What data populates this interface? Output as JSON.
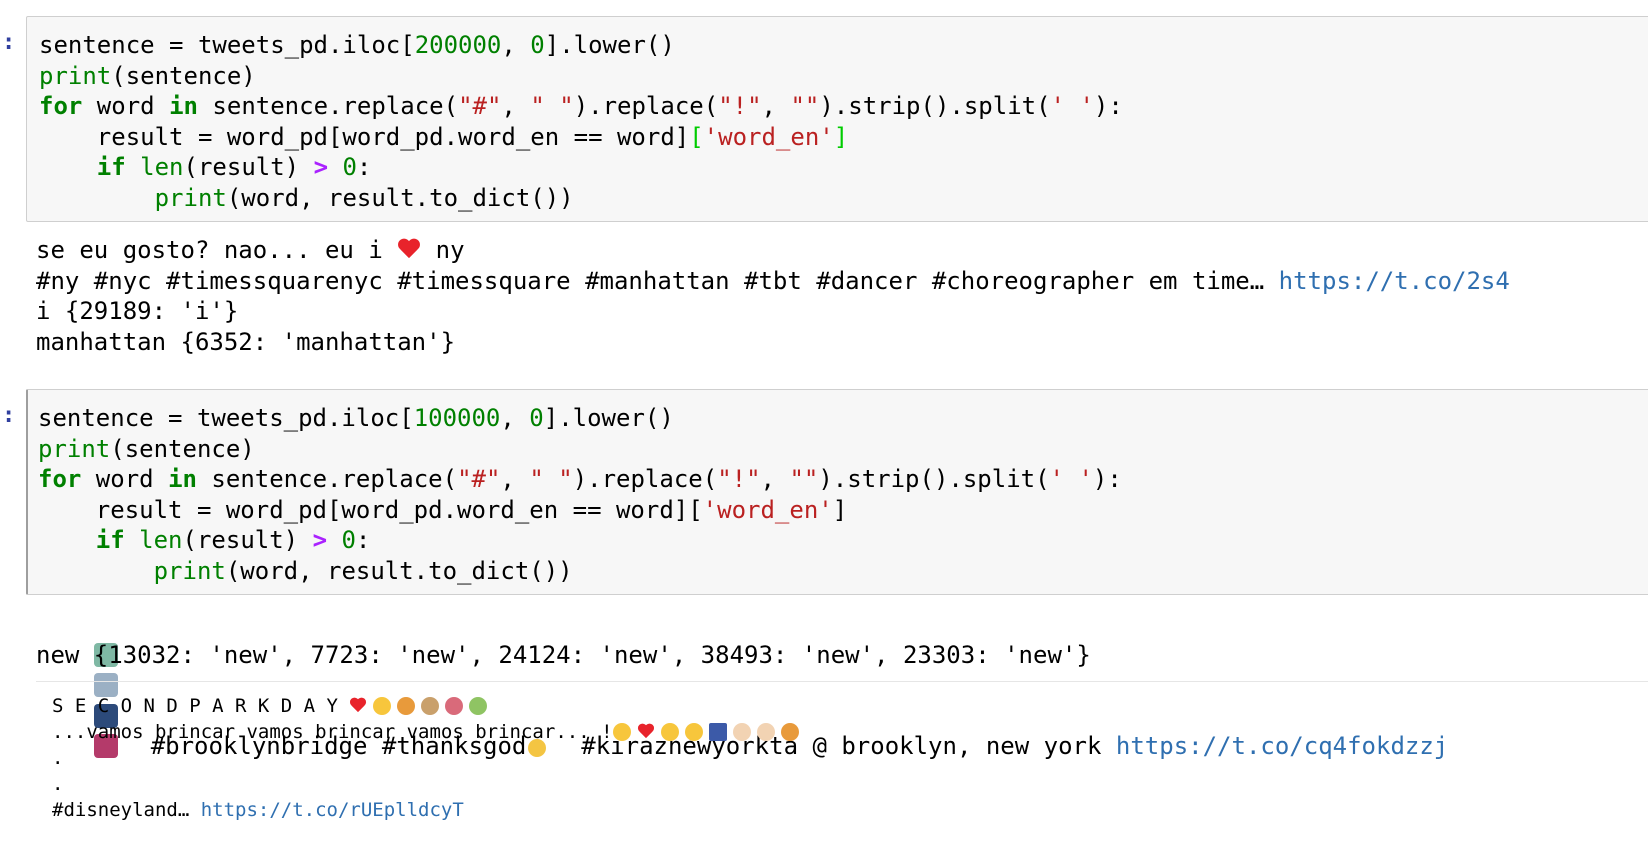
{
  "cells": [
    {
      "prompt": ":",
      "code": {
        "l1": {
          "a": "sentence = tweets_pd.iloc[",
          "n1": "200000",
          ", ": ", ",
          "n2": "0",
          "b": "].lower()"
        },
        "l2": {
          "fn": "print",
          "rest": "(sentence)"
        },
        "l3": {
          "kw1": "for",
          "mid1": " word ",
          "kw2": "in",
          "mid2": " sentence.replace(",
          "s1": "\"#\"",
          "c1": ", ",
          "s2": "\" \"",
          "mid3": ").replace(",
          "s3": "\"!\"",
          "c2": ", ",
          "s4": "\"\"",
          "mid4": ").strip().split(",
          "s5": "' '",
          "end": "):"
        },
        "l4": {
          "a": "    result = word_pd[word_pd.word_en == word]",
          "b1": "[",
          "s": "'word_en'",
          "b2": "]"
        },
        "l5": {
          "indent": "    ",
          "kw": "if",
          "sp": " ",
          "fn": "len",
          "mid": "(result) ",
          "op": ">",
          "sp2": " ",
          "n": "0",
          ":": ":"
        },
        "l6": {
          "indent": "        ",
          "fn": "print",
          "rest": "(word, result.to_dict())"
        }
      },
      "output": {
        "line1a": "se eu gosto? nao... eu i ",
        "line1b": " ny",
        "line2a": "#ny #nyc #timessquarenyc #timessquare #manhattan #tbt #dancer #choreographer em time… ",
        "line2link": "https://t.co/2s4",
        "line3": "i {29189: 'i'}",
        "line4": "manhattan {6352: 'manhattan'}"
      }
    },
    {
      "prompt": ":",
      "code": {
        "l1": {
          "a": "sentence = tweets_pd.iloc[",
          "n1": "100000",
          ", ": ", ",
          "n2": "0",
          "b": "].lower()"
        },
        "l2": {
          "fn": "print",
          "rest": "(sentence)"
        },
        "l3": {
          "kw1": "for",
          "mid1": " word ",
          "kw2": "in",
          "mid2": " sentence.replace(",
          "s1": "\"#\"",
          "c1": ", ",
          "s2": "\" \"",
          "mid3": ").replace(",
          "s3": "\"!\"",
          "c2": ", ",
          "s4": "\"\"",
          "mid4": ").strip().split(",
          "s5": "' '",
          "end": "):"
        },
        "l4": {
          "a": "    result = word_pd[word_pd.word_en == word][",
          "s": "'word_en'",
          "b2": "]"
        },
        "l5": {
          "indent": "    ",
          "kw": "if",
          "sp": " ",
          "fn": "len",
          "mid": "(result) ",
          "op": ">",
          "sp2": " ",
          "n": "0",
          ":": ":"
        },
        "l6": {
          "indent": "        ",
          "fn": "print",
          "rest": "(word, result.to_dict())"
        }
      },
      "output": {
        "line1a": "  #brooklynbridge #thanksgod",
        "line1b": "  #kiraznewyorkta @ brooklyn, new york ",
        "line1link": "https://t.co/cq4fokdzzj",
        "line2": "new {13032: 'new', 7723: 'new', 24124: 'new', 38493: 'new', 23303: 'new'}"
      }
    }
  ],
  "output3": {
    "line1": "S E C O N D P A R K D A Y ",
    "line2": "...vamos brincar vamos brincar vamos brincar... !",
    "line3": ".",
    "line4": ".",
    "line5a": "#disneyland… ",
    "line5link": "https://t.co/rUEplldcyT"
  },
  "colors": {
    "keyword": "#008000",
    "string": "#ba2121",
    "operator": "#aa22ff",
    "link": "#2f6fb0",
    "prompt": "#303f9f"
  },
  "icons": [
    "statue-of-liberty-icon",
    "ship-icon",
    "bridge-icon",
    "cityscape-icon",
    "pray-icon",
    "heart-icon",
    "sparkle-icon",
    "party-icon",
    "carousel-icon",
    "ferris-wheel-icon",
    "roller-coaster-icon",
    "winking-tongue-icon",
    "wink-icon",
    "sunglasses-icon",
    "us-flag-icon",
    "thumbs-up-icon"
  ]
}
